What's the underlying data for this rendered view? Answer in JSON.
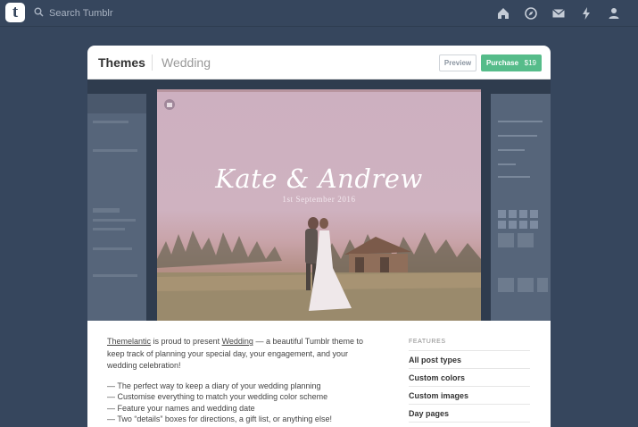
{
  "topbar": {
    "logo_letter": "t",
    "search_placeholder": "Search Tumblr",
    "icons": [
      "home-icon",
      "compass-icon",
      "mail-icon",
      "lightning-icon",
      "account-icon"
    ]
  },
  "card": {
    "title": "Themes",
    "subtitle": "Wedding",
    "preview_label": "Preview",
    "purchase_label": "Purchase",
    "price": "$19"
  },
  "hero": {
    "title": "Kate & Andrew",
    "date": "1st September 2016"
  },
  "description": {
    "author_link": "Themelantic",
    "text_1": " is proud to present ",
    "theme_link": "Wedding",
    "text_2": " — a beautiful Tumblr theme to keep track of planning your special day, your engagement, and your wedding celebration!",
    "bullets": [
      "— The perfect way to keep a diary of your wedding planning",
      "— Customise everything to match your wedding color scheme",
      "— Feature your names and wedding date",
      "— Two “details” boxes for directions, a gift list, or anything else!"
    ]
  },
  "features": {
    "heading": "FEATURES",
    "items": [
      "All post types",
      "Custom colors",
      "Custom images",
      "Day pages"
    ]
  },
  "colors": {
    "background": "#36465d",
    "purchase": "#56bc8a"
  }
}
